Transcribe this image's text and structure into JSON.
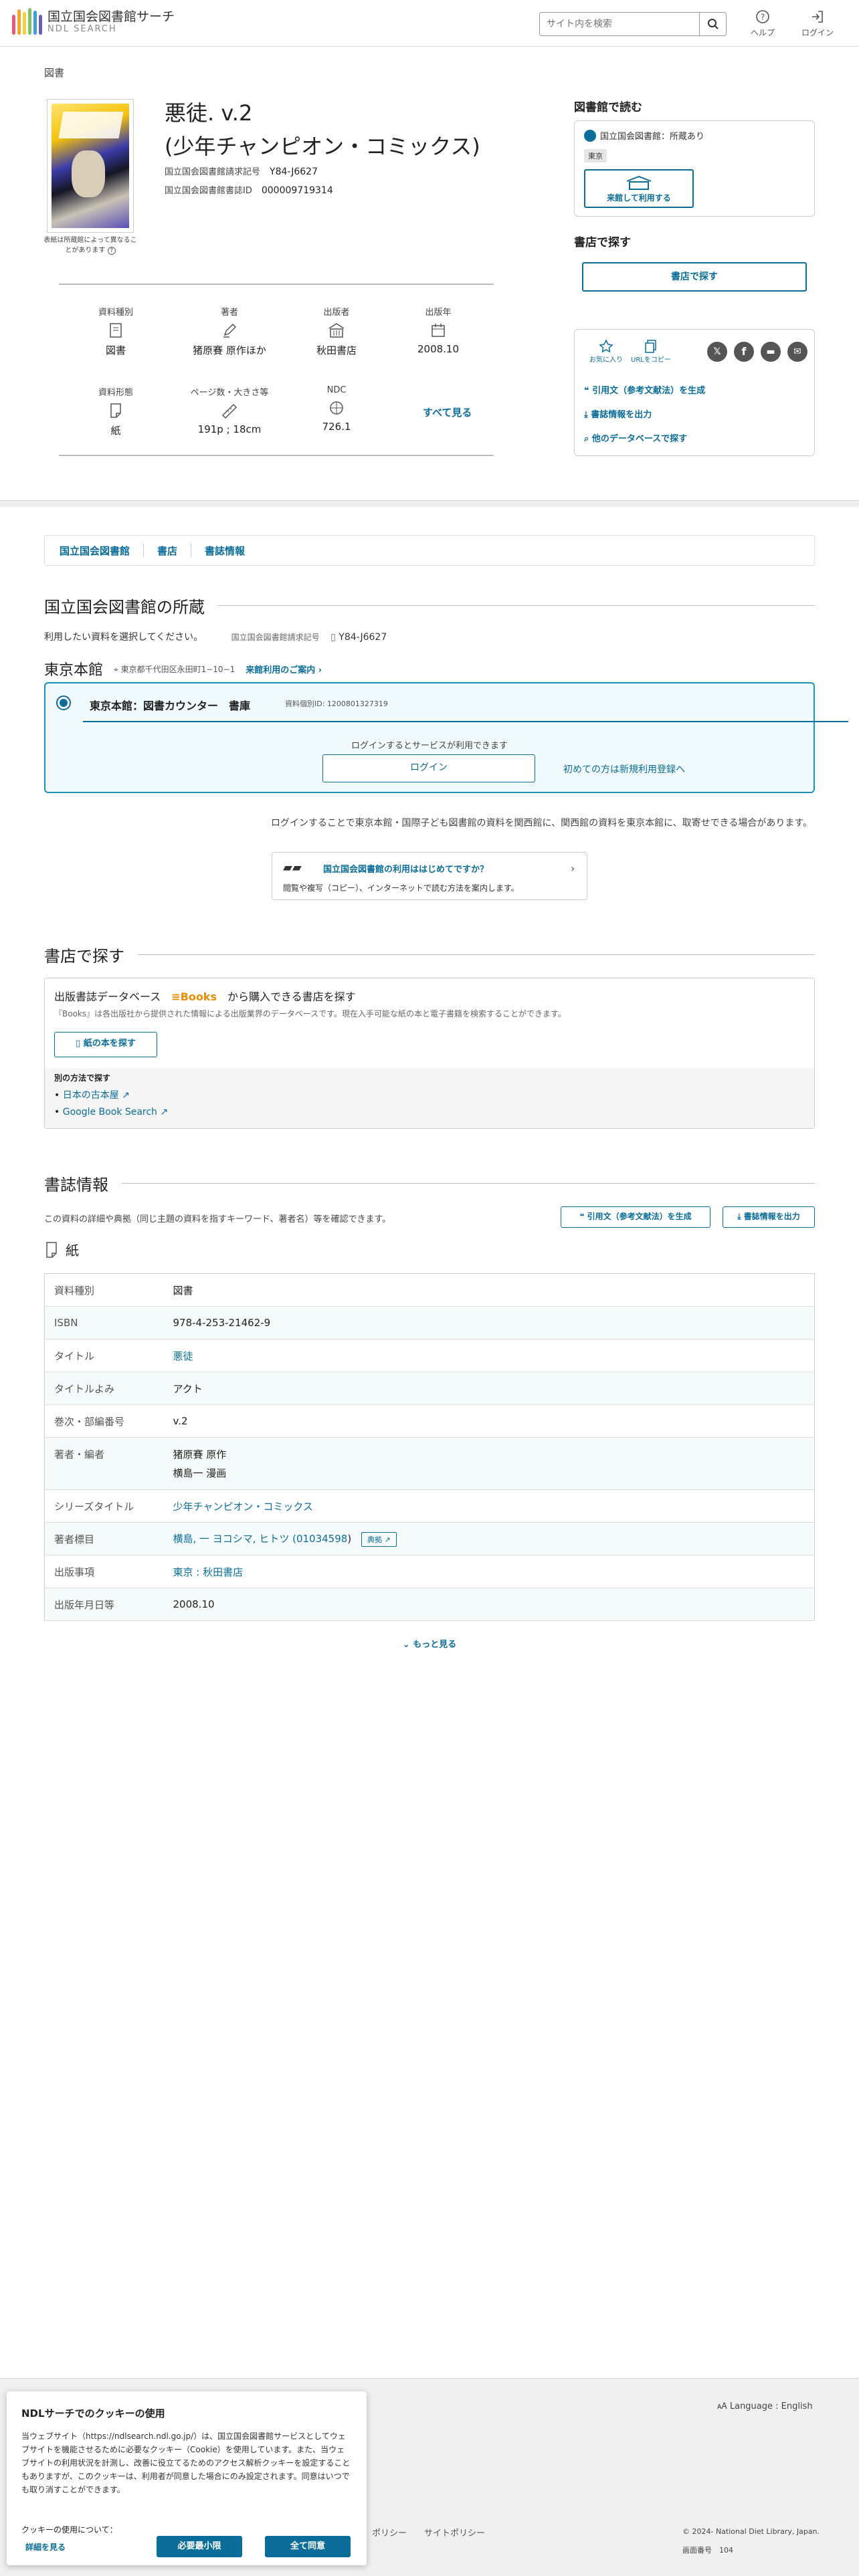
{
  "header": {
    "logo_title": "国立国会図書館サーチ",
    "logo_sub": "NDL SEARCH",
    "search_placeholder": "サイト内を検索",
    "help_label": "ヘルプ",
    "login_label": "ログイン",
    "logo_colors": [
      "#e85a7a",
      "#f4a32b",
      "#f3d13a",
      "#7dc36b",
      "#3aa0d8",
      "#6a5fb5"
    ]
  },
  "breadcrumb": "図書",
  "book": {
    "title_line1": "悪徒. v.2",
    "title_line2": "(少年チャンピオン・コミックス)",
    "call_number_label": "国立国会図書館請求記号",
    "call_number": "Y84-J6627",
    "ndl_id_label": "国立国会図書館書誌ID",
    "ndl_id": "000009719314",
    "thumb_note": "表紙は所蔵館によって異なることがあります"
  },
  "props": [
    {
      "label": "資料種別",
      "value": "図書",
      "icon": "book-icon"
    },
    {
      "label": "著者",
      "value": "猪原賽 原作ほか",
      "icon": "pen-icon"
    },
    {
      "label": "出版者",
      "value": "秋田書店",
      "icon": "building-icon"
    },
    {
      "label": "出版年",
      "value": "2008.10",
      "icon": "calendar-icon"
    },
    {
      "label": "資料形態",
      "value": "紙",
      "icon": "paper-icon"
    },
    {
      "label": "ページ数・大きさ等",
      "value": "191p ; 18cm",
      "icon": "ruler-icon"
    },
    {
      "label": "NDC",
      "value": "726.1",
      "icon": "ndc-icon"
    }
  ],
  "see_all": "すべて見る",
  "right": {
    "read_heading": "図書館で読む",
    "ndl_status": "国立国会図書館：所蔵あり",
    "tokyo_tag": "東京",
    "visit_button": "来館して利用する",
    "shop_heading": "書店で探す",
    "shop_button": "書店で探す",
    "fav_label": "お気に入り",
    "url_label": "URLをコピー",
    "cite_link": "引用文（参考文献法）を生成",
    "export_link": "書誌情報を出力",
    "other_db_link": "他のデータベースで探す"
  },
  "tabs": [
    "国立国会図書館",
    "書店",
    "書誌情報"
  ],
  "holdings": {
    "heading": "国立国会図書館の所蔵",
    "select_text": "利用したい資料を選択してください。",
    "call_label": "国立国会図書館請求記号",
    "call_value": "Y84-J6627",
    "branch": "東京本館",
    "address": "東京都千代田区永田町1−10−1",
    "visit_guide": "来館利用のご案内",
    "counter": "東京本館：図書カウンター　書庫",
    "item_id": "資料個別ID: 1200801327319",
    "login_note": "ログインするとサービスが利用できます",
    "login_button": "ログイン",
    "register_link": "初めての方は新規利用登録へ",
    "notice": "ログインすることで東京本館・国際子ども図書館の資料を関西館に、関西館の資料を東京本館に、取寄せできる場合があります。",
    "guide_title": "国立国会図書館の利用ははじめてですか？",
    "guide_desc": "閲覧や複写（コピー）、インターネットで読む方法を案内します。"
  },
  "shop": {
    "heading": "書店で探す",
    "db_title_pre": "出版書誌データベース",
    "db_title_brand": "Books",
    "db_title_post": "から購入できる書店を探す",
    "db_desc": "『Books』は各出版社から提供された情報による出版業界のデータベースです。現在入手可能な紙の本と電子書籍を検索することができます。",
    "paper_button": "紙の本を探す",
    "other_label": "別の方法で探す",
    "links": [
      "日本の古本屋",
      "Google Book Search"
    ]
  },
  "biblio": {
    "heading": "書誌情報",
    "desc": "この資料の詳細や典拠（同じ主題の資料を指すキーワード、著者名）等を確認できます。",
    "cite_button": "引用文（参考文献法）を生成",
    "export_button": "書誌情報を出力",
    "format": "紙",
    "rows": [
      {
        "k": "資料種別",
        "v": "図書"
      },
      {
        "k": "ISBN",
        "v": "978-4-253-21462-9"
      },
      {
        "k": "タイトル",
        "v": "悪徒"
      },
      {
        "k": "タイトルよみ",
        "v": "アクト"
      },
      {
        "k": "巻次・部編番号",
        "v": "v.2"
      },
      {
        "k": "著者・編者",
        "v": "猪原賽 原作",
        "v2": "横島一 漫画"
      },
      {
        "k": "シリーズタイトル",
        "v": "少年チャンピオン・コミックス"
      },
      {
        "k": "著者標目",
        "v": "横島, 一 ヨコシマ, ヒトツ (",
        "v_link": "01034598",
        "v_end": ")",
        "badge": "典拠"
      },
      {
        "k": "出版事項",
        "v": "東京 : 秋田書店"
      },
      {
        "k": "出版年月日等",
        "v": "2008.10"
      }
    ],
    "more": "もっと見る"
  },
  "footer": {
    "language": "Language : English",
    "policy1": "ポリシー",
    "policy2": "サイトポリシー",
    "copyright": "© 2024- National Diet Library, Japan.",
    "screen_no_label": "画面番号",
    "screen_no": "104"
  },
  "cookie": {
    "title": "NDLサーチでのクッキーの使用",
    "body": "当ウェブサイト（https://ndlsearch.ndl.go.jp/）は、国立国会図書館サービスとしてウェブサイトを機能させるために必要なクッキー（Cookie）を使用しています。また、当ウェブサイトの利用状況を計測し、改善に役立てるためのアクセス解析クッキーを設定することもありますが、このクッキーは、利用者が同意した場合にのみ設定されます。同意はいつでも取り消すことができます。",
    "about_label": "クッキーの使用について：",
    "details_link": "詳細を見る",
    "necessary_button": "必要最小限",
    "accept_button": "全て同意"
  }
}
